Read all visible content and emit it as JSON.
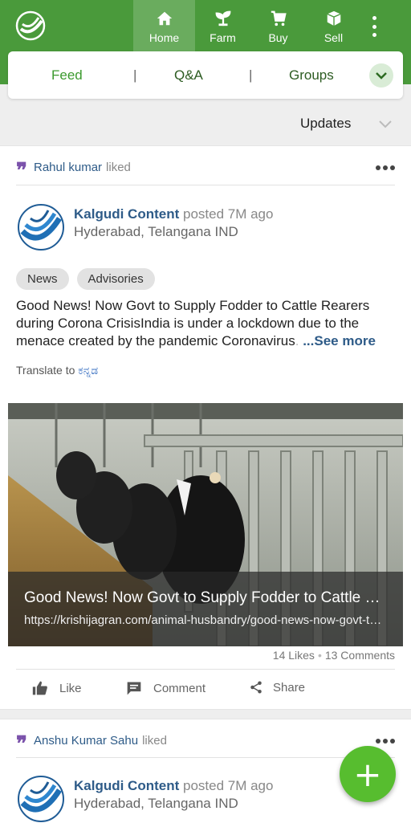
{
  "nav": {
    "items": [
      {
        "label": "Home",
        "icon": "home-icon",
        "active": true
      },
      {
        "label": "Farm",
        "icon": "sprout-icon",
        "active": false
      },
      {
        "label": "Buy",
        "icon": "cart-icon",
        "active": false
      },
      {
        "label": "Sell",
        "icon": "box-icon",
        "active": false
      }
    ]
  },
  "tabs": {
    "feed": "Feed",
    "qa": "Q&A",
    "groups": "Groups",
    "separator": "|"
  },
  "filter": {
    "label": "Updates"
  },
  "posts": [
    {
      "liked_by": "Rahul kumar",
      "liked_suffix": "liked",
      "author": "Kalgudi Content",
      "posted": "posted 7M ago",
      "location": "Hyderabad, Telangana IND",
      "tags": [
        "News",
        "Advisories"
      ],
      "text_main": "Good News! Now Govt to Supply Fodder to Cattle Rearers during Corona CrisisIndia is under a lockdown due to the menace created by the pandemic Coronavirus",
      "text_fade": ". ",
      "see_more": "...See more",
      "translate_prefix": "Translate to",
      "translate_lang": "ಕನ್ನಡ",
      "media_title": "Good News! Now Govt to Supply Fodder to Cattle Rearers during Corona Crisis",
      "media_url": "https://krishijagran.com/animal-husbandry/good-news-now-govt-to-supply-fodder",
      "likes": "14 Likes",
      "bullet": "•",
      "comments": "13 Comments",
      "actions": {
        "like": "Like",
        "comment": "Comment",
        "share": "Share"
      }
    },
    {
      "liked_by": "Anshu Kumar Sahu",
      "liked_suffix": "liked",
      "author": "Kalgudi Content",
      "posted": "posted 7M ago",
      "location": "Hyderabad, Telangana IND"
    }
  ],
  "fab": {
    "label": "+"
  },
  "colors": {
    "primary": "#4a9a3b",
    "fab": "#57bd2f",
    "link": "#2e5b88",
    "quote": "#7b52ab"
  }
}
